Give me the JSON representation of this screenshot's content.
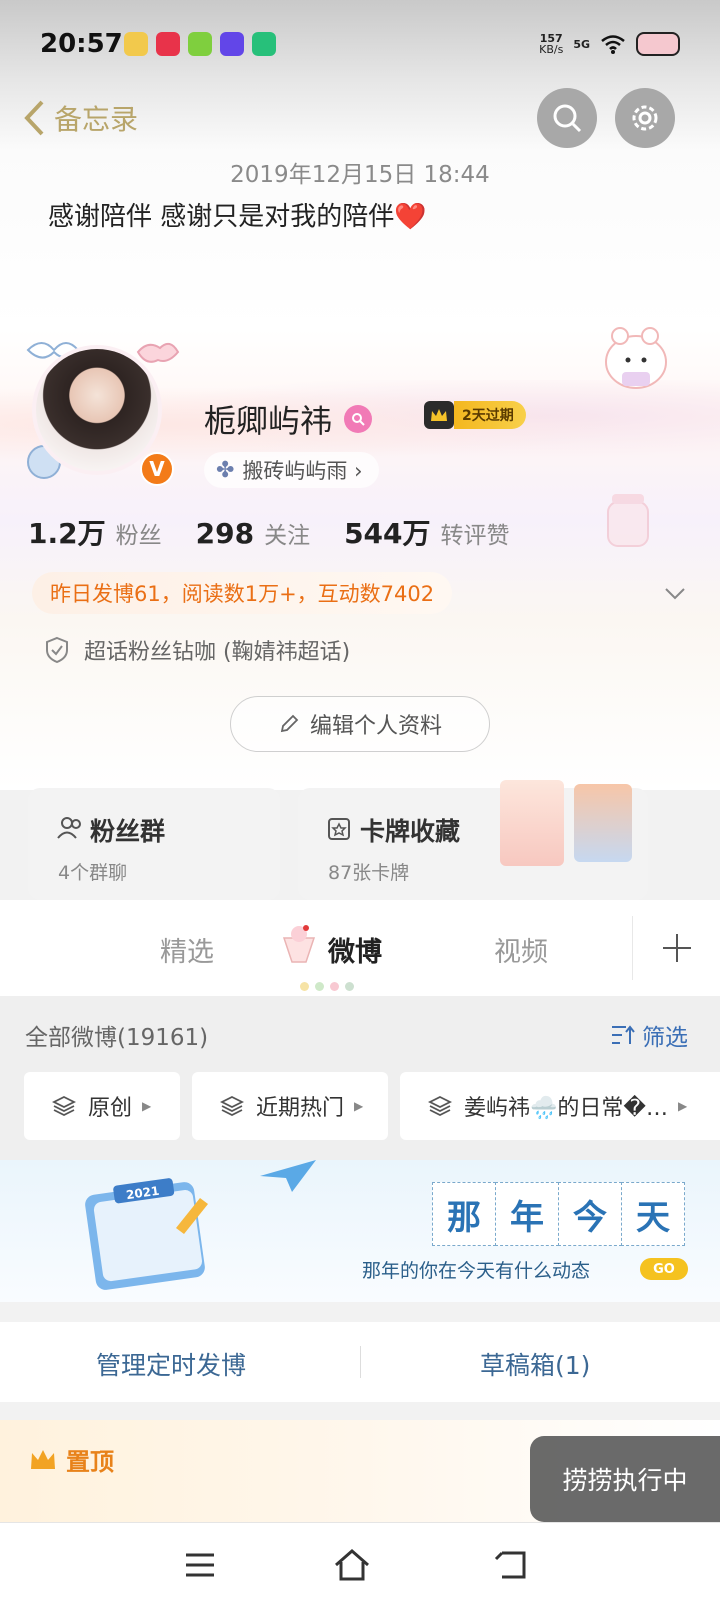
{
  "status_bar": {
    "time": "20:57",
    "net_speed": "157",
    "net_unit": "KB/s",
    "signal": "5G"
  },
  "nav": {
    "back_label": "备忘录"
  },
  "memo": {
    "date": "2019年12月15日 18:44",
    "text": "感谢陪伴 感谢只是对我的陪伴",
    "emoji": "❤️"
  },
  "profile": {
    "name": "栀卿屿祎",
    "vip_tag": "2天过期",
    "sub_tag": "搬砖屿屿雨 ›",
    "verified_badge": "V"
  },
  "stats": [
    {
      "value": "1.2万",
      "label": "粉丝"
    },
    {
      "value": "298",
      "label": "关注"
    },
    {
      "value": "544万",
      "label": "转评赞"
    }
  ],
  "daily": "昨日发博61，阅读数1万+，互动数7402",
  "supertopic": "超话粉丝钻咖 (鞠婧祎超话)",
  "edit_profile": "编辑个人资料",
  "cards": {
    "fans_group": {
      "title": "粉丝群",
      "sub": "4个群聊"
    },
    "card_collection": {
      "title": "卡牌收藏",
      "sub": "87张卡牌"
    }
  },
  "tabs": [
    "精选",
    "微博",
    "视频"
  ],
  "feed": {
    "all_label": "全部微博(19161)",
    "filter_label": "筛选",
    "chips": [
      "原创",
      "近期热门",
      "姜屿祎🌧️的日常�…"
    ]
  },
  "banner": {
    "chars": [
      "那",
      "年",
      "今",
      "天"
    ],
    "subtitle": "那年的你在今天有什么动态",
    "go": "GO",
    "calendar_year": "2021"
  },
  "manage": {
    "left": "管理定时发博",
    "right": "草稿箱(1)"
  },
  "pinned": {
    "label": "置顶"
  },
  "toast": "捞捞执行中",
  "colors": {
    "accent_orange": "#ea6f15",
    "link_blue": "#3c6894",
    "vip_gold": "#f4b71f"
  }
}
